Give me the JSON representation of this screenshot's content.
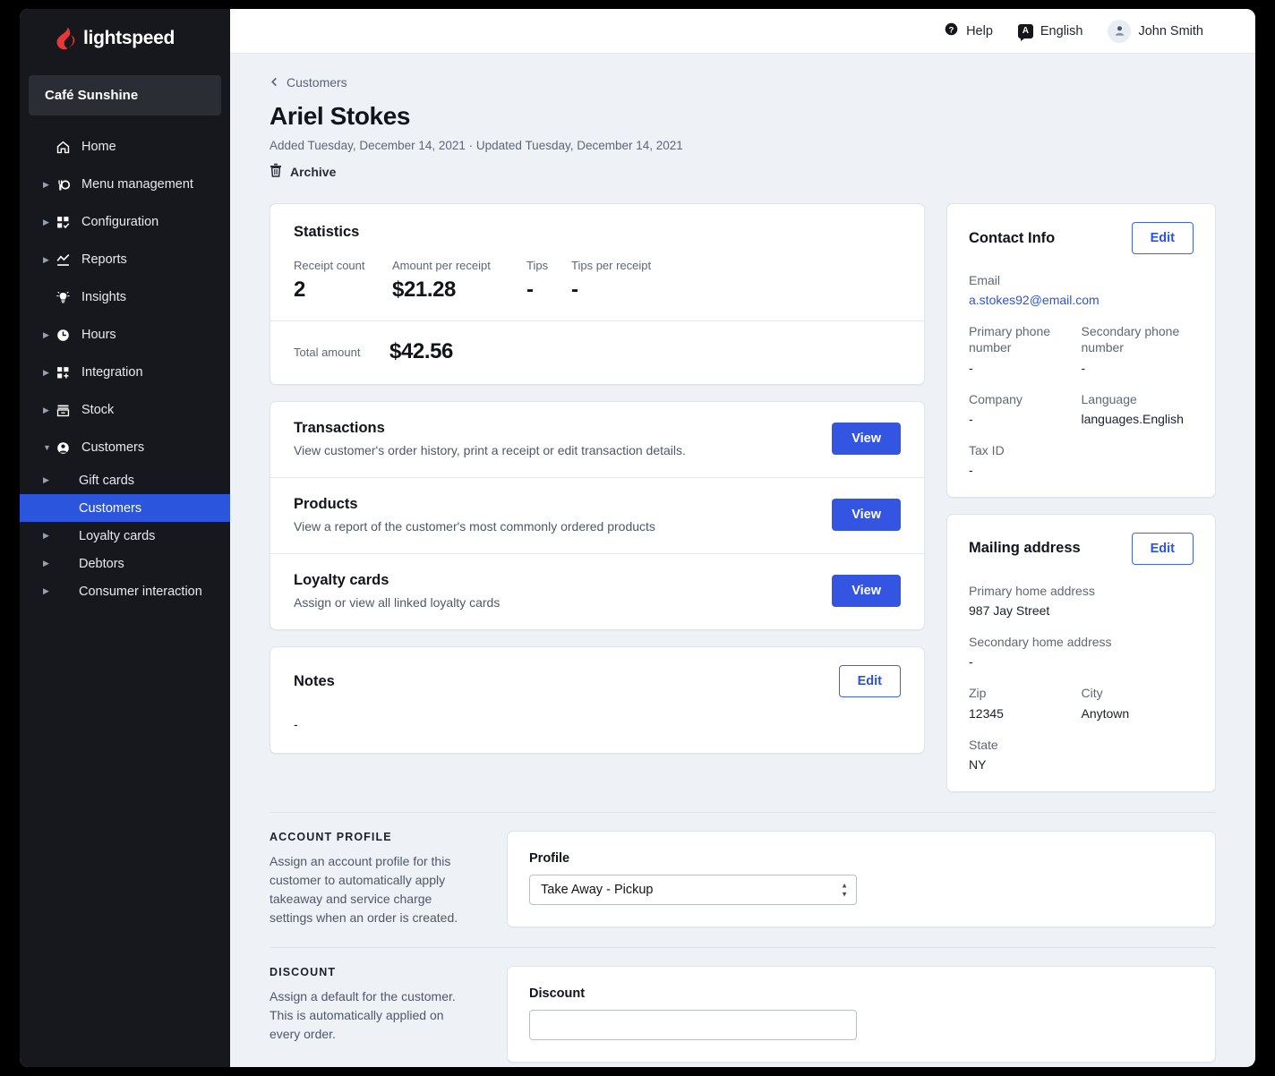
{
  "brand": {
    "name": "lightspeed",
    "store": "Café Sunshine"
  },
  "topbar": {
    "help": "Help",
    "language": "English",
    "language_badge": "A",
    "user": "John Smith"
  },
  "sidebar": {
    "items": [
      {
        "label": "Home",
        "icon": "home-icon",
        "expandable": false
      },
      {
        "label": "Menu management",
        "icon": "menu-management-icon",
        "expandable": true
      },
      {
        "label": "Configuration",
        "icon": "configuration-icon",
        "expandable": true
      },
      {
        "label": "Reports",
        "icon": "reports-icon",
        "expandable": true
      },
      {
        "label": "Insights",
        "icon": "insights-icon",
        "expandable": false
      },
      {
        "label": "Hours",
        "icon": "hours-icon",
        "expandable": true
      },
      {
        "label": "Integration",
        "icon": "integration-icon",
        "expandable": true
      },
      {
        "label": "Stock",
        "icon": "stock-icon",
        "expandable": true
      },
      {
        "label": "Customers",
        "icon": "customers-icon",
        "expandable": true,
        "expanded": true
      }
    ],
    "subitems": [
      {
        "label": "Gift cards",
        "active": false
      },
      {
        "label": "Customers",
        "active": true
      },
      {
        "label": "Loyalty cards",
        "active": false
      },
      {
        "label": "Debtors",
        "active": false
      },
      {
        "label": "Consumer interaction",
        "active": false
      }
    ]
  },
  "page": {
    "breadcrumb": "Customers",
    "title": "Ariel Stokes",
    "meta": "Added Tuesday, December 14, 2021 · Updated Tuesday, December 14, 2021",
    "archive": "Archive"
  },
  "statistics": {
    "title": "Statistics",
    "metrics": [
      {
        "key": "Receipt count",
        "value": "2"
      },
      {
        "key": "Amount per receipt",
        "value": "$21.28"
      },
      {
        "key": "Tips",
        "value": "-"
      },
      {
        "key": "Tips per receipt",
        "value": "-"
      }
    ],
    "total_key": "Total amount",
    "total_value": "$42.56"
  },
  "actions": [
    {
      "title": "Transactions",
      "desc": "View customer's order history, print a receipt or edit transaction details.",
      "button": "View"
    },
    {
      "title": "Products",
      "desc": "View a report of the customer's most commonly ordered products",
      "button": "View"
    },
    {
      "title": "Loyalty cards",
      "desc": "Assign or view all linked loyalty cards",
      "button": "View"
    }
  ],
  "notes": {
    "title": "Notes",
    "edit": "Edit",
    "value": "-"
  },
  "contact_info": {
    "title": "Contact Info",
    "edit": "Edit",
    "email_label": "Email",
    "email_value": "a.stokes92@email.com",
    "primary_phone_label": "Primary phone number",
    "primary_phone_value": "-",
    "secondary_phone_label": "Secondary phone number",
    "secondary_phone_value": "-",
    "company_label": "Company",
    "company_value": "-",
    "language_label": "Language",
    "language_value": "languages.English",
    "tax_id_label": "Tax ID",
    "tax_id_value": "-"
  },
  "mailing_address": {
    "title": "Mailing address",
    "edit": "Edit",
    "primary_label": "Primary home address",
    "primary_value": "987 Jay Street",
    "secondary_label": "Secondary home address",
    "secondary_value": "-",
    "zip_label": "Zip",
    "zip_value": "12345",
    "city_label": "City",
    "city_value": "Anytown",
    "state_label": "State",
    "state_value": "NY"
  },
  "account_profile": {
    "heading": "ACCOUNT PROFILE",
    "desc": "Assign an account profile for this customer to automatically apply takeaway and service charge settings when an order is created.",
    "field_label": "Profile",
    "field_value": "Take Away - Pickup"
  },
  "discount": {
    "heading": "DISCOUNT",
    "desc": "Assign a default for the customer. This is automatically applied on every order.",
    "field_label": "Discount",
    "field_value": ""
  },
  "colors": {
    "accent_blue": "#3355e2",
    "sidebar_bg": "#16181d",
    "active_nav": "#2c55dd",
    "page_bg": "#eef1f6",
    "logo_red": "#e8373b"
  }
}
